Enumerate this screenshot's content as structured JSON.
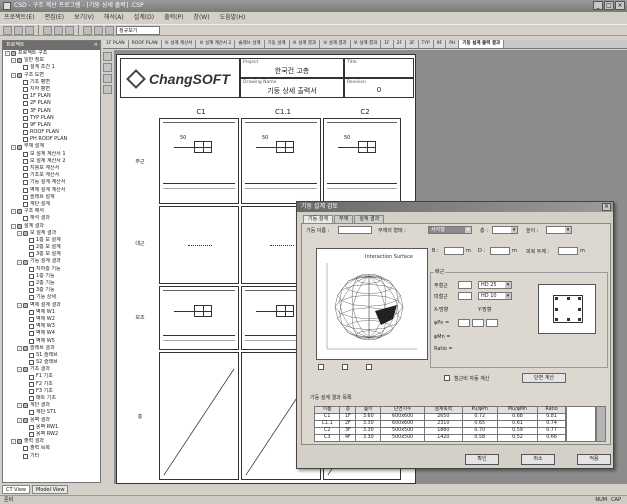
{
  "window": {
    "title": "CSD - 구조 계산 프로그램 - [기둥 상세 출력] .CSP"
  },
  "menu": [
    "프로젝트(E)",
    "편집(E)",
    "보기(V)",
    "해석(A)",
    "설계(D)",
    "출력(P)",
    "창(W)",
    "도움말(H)"
  ],
  "toolbar": {
    "zoom": "정규보기"
  },
  "tree": {
    "title": "프로젝트",
    "nodes": [
      {
        "label": "프로젝트 구조",
        "icon": "folder",
        "exp": "-",
        "lvl": 0
      },
      {
        "label": "일반 정보",
        "icon": "folder",
        "exp": "-",
        "lvl": 1
      },
      {
        "label": "설계 조건 1",
        "icon": "doc",
        "exp": "",
        "lvl": 2
      },
      {
        "label": "구조 도면",
        "icon": "folder",
        "exp": "-",
        "lvl": 1
      },
      {
        "label": "기초 평면",
        "icon": "doc",
        "exp": "",
        "lvl": 2
      },
      {
        "label": "지하 평면",
        "icon": "doc",
        "exp": "",
        "lvl": 2
      },
      {
        "label": "1F PLAN",
        "icon": "doc",
        "exp": "",
        "lvl": 2
      },
      {
        "label": "2F PLAN",
        "icon": "doc",
        "exp": "",
        "lvl": 2
      },
      {
        "label": "3F PLAN",
        "icon": "doc",
        "exp": "",
        "lvl": 2
      },
      {
        "label": "TYP PLAN",
        "icon": "doc",
        "exp": "",
        "lvl": 2
      },
      {
        "label": "9F PLAN",
        "icon": "doc",
        "exp": "",
        "lvl": 2
      },
      {
        "label": "ROOF PLAN",
        "icon": "doc",
        "exp": "",
        "lvl": 2
      },
      {
        "label": "PH ROOF PLAN",
        "icon": "doc",
        "exp": "",
        "lvl": 2
      },
      {
        "label": "부재 설계",
        "icon": "folder",
        "exp": "-",
        "lvl": 1
      },
      {
        "label": "보 설계 계산서 1",
        "icon": "doc",
        "exp": "",
        "lvl": 2
      },
      {
        "label": "보 설계 계산서 2",
        "icon": "doc",
        "exp": "",
        "lvl": 2
      },
      {
        "label": "지붕보 계산서",
        "icon": "doc",
        "exp": "",
        "lvl": 2
      },
      {
        "label": "기초보 계산서",
        "icon": "doc",
        "exp": "",
        "lvl": 2
      },
      {
        "label": "기둥 설계 계산서",
        "icon": "doc",
        "exp": "",
        "lvl": 2
      },
      {
        "label": "벽체 설계 계산서",
        "icon": "doc",
        "exp": "",
        "lvl": 2
      },
      {
        "label": "슬래브 설계",
        "icon": "doc",
        "exp": "",
        "lvl": 2
      },
      {
        "label": "계단 설계",
        "icon": "doc",
        "exp": "",
        "lvl": 2
      },
      {
        "label": "구조 해석",
        "icon": "folder",
        "exp": "-",
        "lvl": 1
      },
      {
        "label": "해석 결과",
        "icon": "doc",
        "exp": "",
        "lvl": 2
      },
      {
        "label": "설계 결과",
        "icon": "folder",
        "exp": "-",
        "lvl": 1
      },
      {
        "label": "보 설계 결과",
        "icon": "folder",
        "exp": "-",
        "lvl": 2
      },
      {
        "label": "1층 보 설계",
        "icon": "doc",
        "exp": "",
        "lvl": 3
      },
      {
        "label": "2층 보 설계",
        "icon": "doc",
        "exp": "",
        "lvl": 3
      },
      {
        "label": "3층 보 설계",
        "icon": "doc",
        "exp": "",
        "lvl": 3
      },
      {
        "label": "기둥 설계 결과",
        "icon": "folder",
        "exp": "-",
        "lvl": 2
      },
      {
        "label": "지하층 기둥",
        "icon": "doc",
        "exp": "",
        "lvl": 3
      },
      {
        "label": "1층 기둥",
        "icon": "doc",
        "exp": "",
        "lvl": 3
      },
      {
        "label": "2층 기둥",
        "icon": "doc",
        "exp": "",
        "lvl": 3
      },
      {
        "label": "3층 기둥",
        "icon": "doc",
        "exp": "",
        "lvl": 3
      },
      {
        "label": "기둥 상세",
        "icon": "doc",
        "exp": "",
        "lvl": 3
      },
      {
        "label": "벽체 설계 결과",
        "icon": "folder",
        "exp": "-",
        "lvl": 2
      },
      {
        "label": "벽체 W1",
        "icon": "doc",
        "exp": "",
        "lvl": 3
      },
      {
        "label": "벽체 W2",
        "icon": "doc",
        "exp": "",
        "lvl": 3
      },
      {
        "label": "벽체 W3",
        "icon": "doc",
        "exp": "",
        "lvl": 3
      },
      {
        "label": "벽체 W4",
        "icon": "doc",
        "exp": "",
        "lvl": 3
      },
      {
        "label": "벽체 W5",
        "icon": "doc",
        "exp": "",
        "lvl": 3
      },
      {
        "label": "슬래브 결과",
        "icon": "folder",
        "exp": "-",
        "lvl": 2
      },
      {
        "label": "S1 슬래브",
        "icon": "doc",
        "exp": "",
        "lvl": 3
      },
      {
        "label": "S2 슬래브",
        "icon": "doc",
        "exp": "",
        "lvl": 3
      },
      {
        "label": "기초 결과",
        "icon": "folder",
        "exp": "-",
        "lvl": 2
      },
      {
        "label": "F1 기초",
        "icon": "doc",
        "exp": "",
        "lvl": 3
      },
      {
        "label": "F2 기초",
        "icon": "doc",
        "exp": "",
        "lvl": 3
      },
      {
        "label": "F3 기초",
        "icon": "doc",
        "exp": "",
        "lvl": 3
      },
      {
        "label": "매트 기초",
        "icon": "doc",
        "exp": "",
        "lvl": 3
      },
      {
        "label": "계단 결과",
        "icon": "folder",
        "exp": "-",
        "lvl": 2
      },
      {
        "label": "계단 ST1",
        "icon": "doc",
        "exp": "",
        "lvl": 3
      },
      {
        "label": "옹벽 결과",
        "icon": "folder",
        "exp": "-",
        "lvl": 2
      },
      {
        "label": "옹벽 RW1",
        "icon": "doc",
        "exp": "",
        "lvl": 3
      },
      {
        "label": "옹벽 RW2",
        "icon": "doc",
        "exp": "",
        "lvl": 3
      },
      {
        "label": "출력 결과",
        "icon": "folder",
        "exp": "-",
        "lvl": 1
      },
      {
        "label": "출력 목록",
        "icon": "doc",
        "exp": "",
        "lvl": 2
      },
      {
        "label": "기타",
        "icon": "doc",
        "exp": "",
        "lvl": 2
      }
    ],
    "tabs": [
      "CT View",
      "Model View"
    ]
  },
  "doctabs": [
    "1F PLAN",
    "ROOF PLAN",
    "보 설계 계산서",
    "보 설계 계산서 2",
    "슬래브 설계",
    "기둥 설계",
    "보 설계 결과",
    "보 설계 결과",
    "보 설계 결과",
    "1F",
    "2F",
    "3F",
    "TYP",
    "9F",
    "PH",
    "기둥 설계 출력 결과"
  ],
  "sheet": {
    "logo": "ChangSOFT",
    "project_label": "Project",
    "project_value": "한국건 고층",
    "title_label": "Title",
    "title_value": "",
    "drawing_label": "Drawing Name",
    "drawing_value": "기둥 상세 출력서",
    "revision_label": "Revision",
    "revision_value": "0",
    "columns": [
      "C1",
      "C1.1",
      "C2"
    ],
    "rows": [
      "주근",
      "대근",
      "보조",
      "층"
    ]
  },
  "dialog": {
    "title": "기둥 설계 검토",
    "tabs": [
      "기둥 설계",
      "부재",
      "설계 결과"
    ],
    "member_label": "기둥 이름 :",
    "member_value": "",
    "type_label": "부재의 형태 :",
    "type_value": "사각형",
    "floor_label": "층 :",
    "floor_value": "",
    "height_label": "높이 :",
    "height_value": "",
    "b_label": "B :",
    "b_value": "",
    "unit_m": "m",
    "d_label": "D :",
    "d_value": "",
    "cover_label": "피복 두께 :",
    "cover_value": "",
    "plot_title": "Interaction Surface",
    "rebar_group": "배근",
    "main_bar_label": "주철근",
    "main_bar_value": "",
    "main_bar_type": "HD 25",
    "tie_label": "띠철근",
    "tie_value": "",
    "tie_type": "HD 10",
    "x_label": "X-방향",
    "y_label": "Y-방향",
    "phiPn_label": "φPn =",
    "phiMn_label": "φMn =",
    "ratio_label": "Ratio =",
    "check_label": "철근비 자동 계산",
    "calc_button": "단면 계산",
    "table_title": "기둥 설계 결과 목록",
    "headers": [
      "이름",
      "층",
      "높이",
      "단면치수",
      "설계축력",
      "Pu/φPn",
      "Mu/φMn",
      "Ratio"
    ],
    "rows": [
      [
        "C1",
        "1F",
        "3.60",
        "600x600",
        "2650",
        "0.72",
        "0.68",
        "0.81"
      ],
      [
        "C1.1",
        "2F",
        "3.30",
        "600x600",
        "2310",
        "0.65",
        "0.61",
        "0.74"
      ],
      [
        "C2",
        "3F",
        "3.30",
        "500x500",
        "1880",
        "0.70",
        "0.59",
        "0.77"
      ],
      [
        "C3",
        "4F",
        "3.30",
        "500x500",
        "1420",
        "0.58",
        "0.52",
        "0.66"
      ]
    ],
    "ok_button": "확인",
    "cancel_button": "취소",
    "apply_button": "적용"
  },
  "status": {
    "left": "준비",
    "right": [
      "NUM",
      "CAP"
    ]
  }
}
